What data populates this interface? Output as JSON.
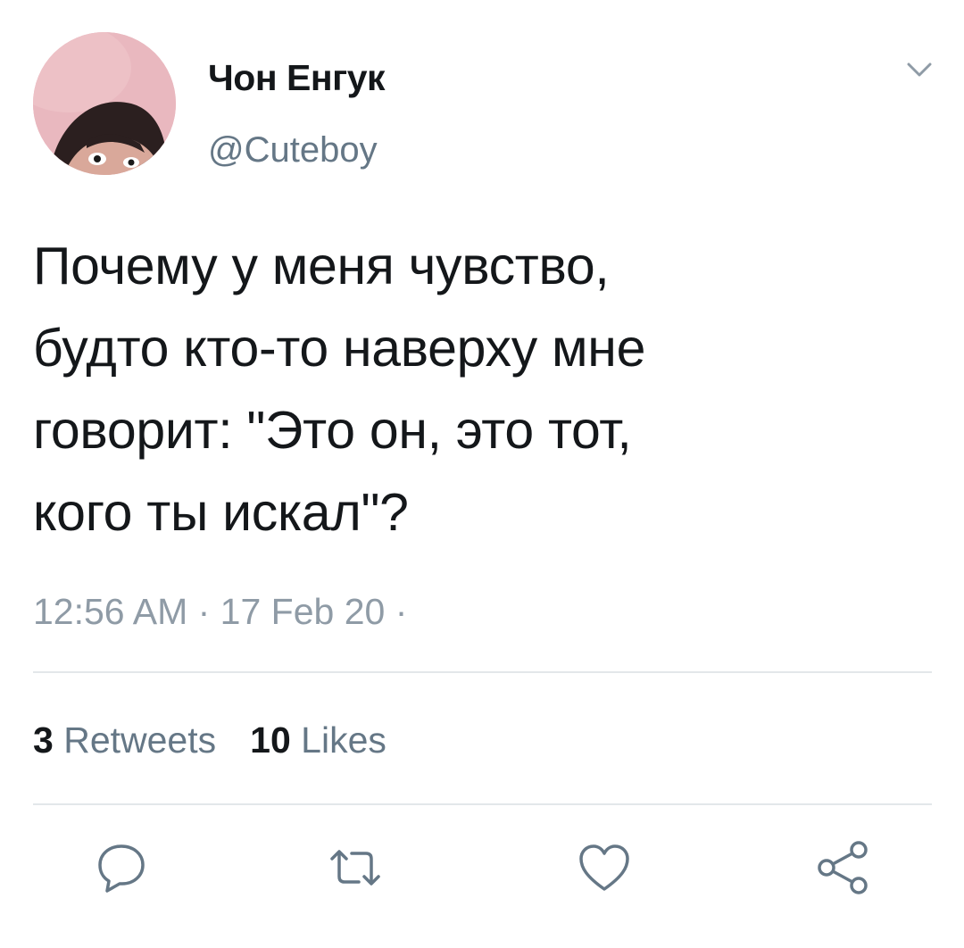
{
  "user": {
    "display_name": "Чон Енгук",
    "handle": "@Cuteboy"
  },
  "tweet": {
    "lines": [
      "Почему у меня чувство,",
      "будто кто-то наверху мне",
      "говорит: \"Это он, это тот,",
      "кого ты искал\"?"
    ],
    "timestamp": "12:56 AM · 17 Feb 20 ·"
  },
  "stats": {
    "retweets_count": "3",
    "retweets_label": "Retweets",
    "likes_count": "10",
    "likes_label": "Likes"
  },
  "actions": {
    "icons": [
      "reply-icon",
      "retweet-icon",
      "like-icon",
      "share-icon"
    ]
  },
  "colors": {
    "text_primary": "#14171a",
    "text_secondary": "#657786",
    "icon": "#657786",
    "divider": "#e3e7ea",
    "avatar_bg": "#e9b8bf"
  }
}
